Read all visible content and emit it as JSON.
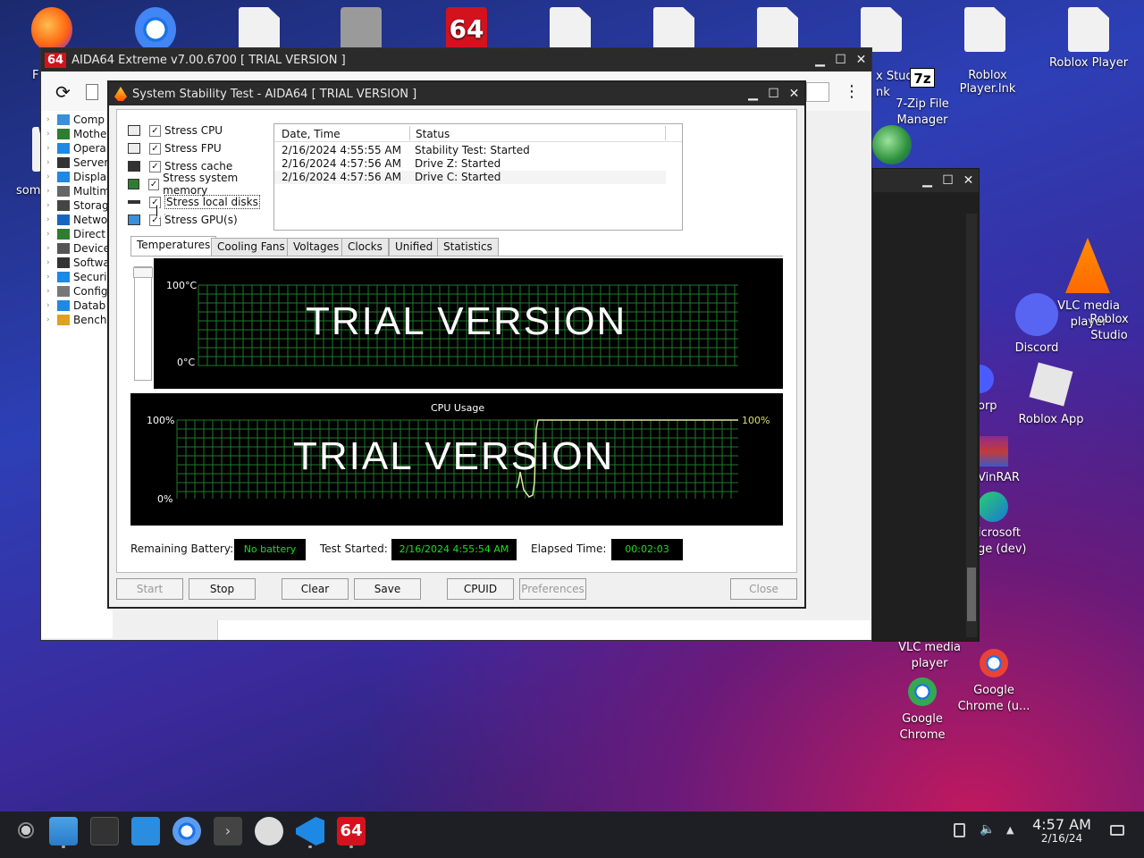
{
  "desktop": {
    "icons": [
      {
        "label": "F",
        "x": 22
      },
      {
        "label": "som",
        "x": 10
      },
      {
        "label": "x Stud\nnk"
      },
      {
        "label": "Roblox Player.lnk"
      },
      {
        "label": "Roblox Player"
      },
      {
        "label": "7-Zip File\nManager"
      },
      {
        "label": "VLC media\nplayer"
      },
      {
        "label": "Roblox\nStudio"
      },
      {
        "label": "Discord"
      },
      {
        "label": "orp"
      },
      {
        "label": "Roblox App"
      },
      {
        "label": "VinRAR"
      },
      {
        "label": "icrosoft\nge (dev)"
      },
      {
        "label": "VLC media\nplayer"
      },
      {
        "label": "Google\nChrome (u..."
      },
      {
        "label": "Google\nChrome"
      }
    ]
  },
  "main_window": {
    "title": "AIDA64 Extreme v7.00.6700  [ TRIAL VERSION ]",
    "logo": "64",
    "tree": [
      {
        "label": "Comp",
        "icon": "computer-icon",
        "color": "#3a8fd8"
      },
      {
        "label": "Mothe",
        "icon": "motherboard-icon",
        "color": "#2e7d32"
      },
      {
        "label": "Opera",
        "icon": "windows-icon",
        "color": "#1e88e5"
      },
      {
        "label": "Server",
        "icon": "server-icon",
        "color": "#333333"
      },
      {
        "label": "Displa",
        "icon": "display-icon",
        "color": "#1e88e5"
      },
      {
        "label": "Multim",
        "icon": "speaker-icon",
        "color": "#666666"
      },
      {
        "label": "Storag",
        "icon": "storage-icon",
        "color": "#444444"
      },
      {
        "label": "Netwo",
        "icon": "network-icon",
        "color": "#1565c0"
      },
      {
        "label": "Direct",
        "icon": "xbox-icon",
        "color": "#2e7d32"
      },
      {
        "label": "Device",
        "icon": "device-icon",
        "color": "#555555"
      },
      {
        "label": "Softwa",
        "icon": "software-icon",
        "color": "#333333"
      },
      {
        "label": "Securi",
        "icon": "shield-icon",
        "color": "#1e88e5"
      },
      {
        "label": "Config",
        "icon": "config-icon",
        "color": "#777777"
      },
      {
        "label": "Datab",
        "icon": "database-icon",
        "color": "#1e88e5"
      },
      {
        "label": "Bench",
        "icon": "benchmark-icon",
        "color": "#e0a020"
      }
    ]
  },
  "bg_window": {
    "title": ""
  },
  "stability": {
    "title": "System Stability Test - AIDA64  [ TRIAL VERSION ]",
    "checks": [
      {
        "label": "Stress CPU",
        "checked": true
      },
      {
        "label": "Stress FPU",
        "checked": true
      },
      {
        "label": "Stress cache",
        "checked": true
      },
      {
        "label": "Stress system memory",
        "checked": true
      },
      {
        "label": "Stress local disks",
        "checked": true
      },
      {
        "label": "Stress GPU(s)",
        "checked": true
      }
    ],
    "log_columns": [
      "Date, Time",
      "Status"
    ],
    "log_rows": [
      [
        "2/16/2024 4:55:55 AM",
        "Stability Test: Started"
      ],
      [
        "2/16/2024 4:57:56 AM",
        "Drive Z: Started"
      ],
      [
        "2/16/2024 4:57:56 AM",
        "Drive C: Started"
      ]
    ],
    "tabs": [
      "Temperatures",
      "Cooling Fans",
      "Voltages",
      "Clocks",
      "Unified",
      "Statistics"
    ],
    "active_tab": "Temperatures",
    "temp_graph": {
      "top_label": "100°C",
      "bottom_label": "0°C",
      "watermark": "TRIAL VERSION"
    },
    "cpu_graph": {
      "title": "CPU Usage",
      "top_label": "100%",
      "bottom_label": "0%",
      "right_label": "100%",
      "watermark": "TRIAL VERSION"
    },
    "battery_label": "Remaining Battery:",
    "battery_value": "No battery",
    "started_label": "Test Started:",
    "started_value": "2/16/2024 4:55:54 AM",
    "elapsed_label": "Elapsed Time:",
    "elapsed_value": "00:02:03",
    "buttons": {
      "start": "Start",
      "stop": "Stop",
      "clear": "Clear",
      "save": "Save",
      "cpuid": "CPUID",
      "preferences": "Preferences",
      "close": "Close"
    }
  },
  "taskbar": {
    "time": "4:57 AM",
    "date": "2/16/24",
    "aida_label": "64"
  }
}
